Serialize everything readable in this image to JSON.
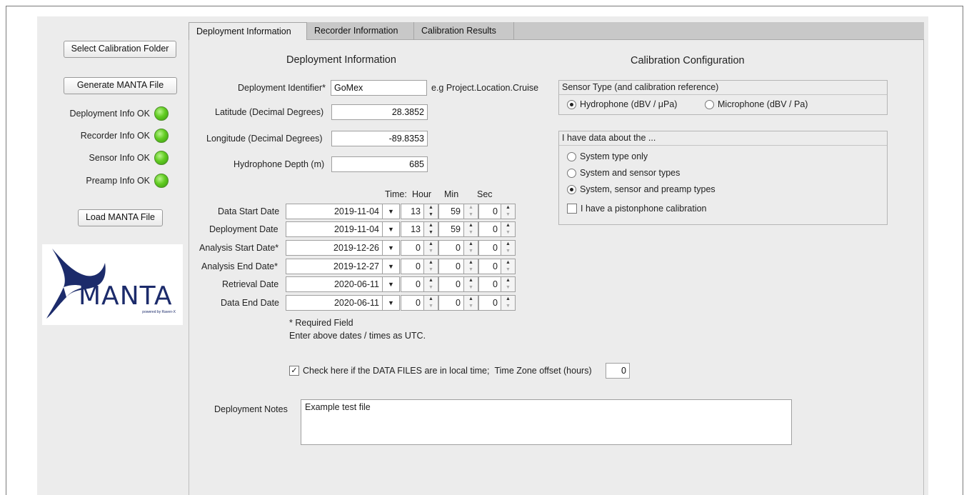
{
  "left_panel": {
    "select_folder_label": "Select Calibration Folder",
    "generate_label": "Generate MANTA File",
    "load_label": "Load MANTA File",
    "statuses": [
      {
        "label": "Deployment Info OK",
        "color": "#5ac21c"
      },
      {
        "label": "Recorder Info OK",
        "color": "#5ac21c"
      },
      {
        "label": "Sensor Info OK",
        "color": "#5ac21c"
      },
      {
        "label": "Preamp Info OK",
        "color": "#5ac21c"
      }
    ],
    "logo": {
      "text": "MANTA",
      "tagline": "powered by Raven-X",
      "color": "#1c2b6b"
    }
  },
  "tabs": [
    {
      "label": "Deployment Information",
      "active": true
    },
    {
      "label": "Recorder Information",
      "active": false
    },
    {
      "label": "Calibration Results",
      "active": false
    }
  ],
  "deployment": {
    "heading": "Deployment Information",
    "identifier_label": "Deployment Identifier*",
    "identifier_value": "GoMex",
    "identifier_hint": "e.g Project.Location.Cruise",
    "latitude_label": "Latitude (Decimal Degrees)",
    "latitude_value": "28.3852",
    "longitude_label": "Longitude (Decimal Degrees)",
    "longitude_value": "-89.8353",
    "depth_label": "Hydrophone Depth (m)",
    "depth_value": "685",
    "time_header": {
      "time": "Time:",
      "hour": "Hour",
      "min": "Min",
      "sec": "Sec"
    },
    "dates": [
      {
        "label": "Data Start Date",
        "date": "2019-11-04",
        "hour": "13",
        "min": "59",
        "sec": "0"
      },
      {
        "label": "Deployment Date",
        "date": "2019-11-04",
        "hour": "13",
        "min": "59",
        "sec": "0"
      },
      {
        "label": "Analysis Start Date*",
        "date": "2019-12-26",
        "hour": "0",
        "min": "0",
        "sec": "0"
      },
      {
        "label": "Analysis End Date*",
        "date": "2019-12-27",
        "hour": "0",
        "min": "0",
        "sec": "0"
      },
      {
        "label": "Retrieval Date",
        "date": "2020-06-11",
        "hour": "0",
        "min": "0",
        "sec": "0"
      },
      {
        "label": "Data End Date",
        "date": "2020-06-11",
        "hour": "0",
        "min": "0",
        "sec": "0"
      }
    ],
    "required_note": "* Required Field",
    "utc_note": "Enter above dates / times as UTC.",
    "local_time_checked": true,
    "local_time_label": "Check here if the DATA FILES are in local time;",
    "tz_label": "Time Zone offset (hours)",
    "tz_value": "0",
    "notes_label": "Deployment Notes",
    "notes_value": "Example test file"
  },
  "calibration": {
    "heading": "Calibration Configuration",
    "sensor_type_title": "Sensor Type (and calibration reference)",
    "sensor_options": [
      {
        "label": "Hydrophone (dBV / μPa)",
        "selected": true
      },
      {
        "label": "Microphone (dBV / Pa)",
        "selected": false
      }
    ],
    "data_about_title": "I have data about the ...",
    "data_options": [
      {
        "label": "System type only",
        "selected": false
      },
      {
        "label": "System and sensor types",
        "selected": false
      },
      {
        "label": "System, sensor and preamp types",
        "selected": true
      }
    ],
    "pistonphone_checked": false,
    "pistonphone_label": "I have a pistonphone calibration"
  }
}
